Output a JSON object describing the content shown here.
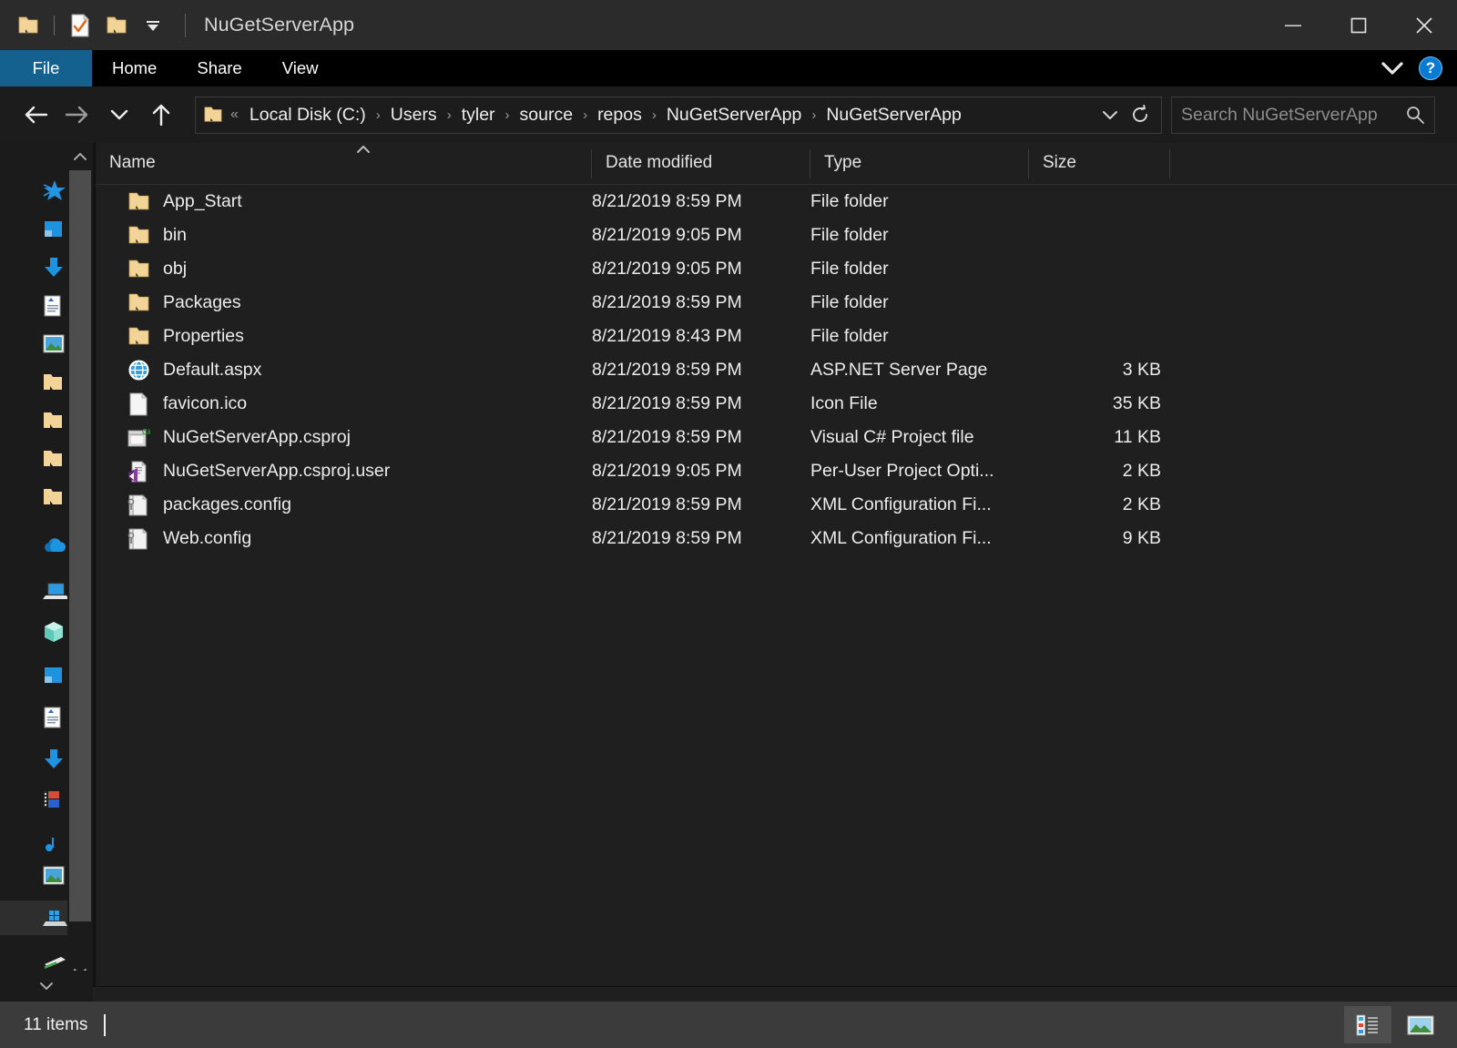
{
  "window": {
    "title": "NuGetServerApp",
    "controls": {
      "minimize": "minimize-icon",
      "maximize": "maximize-icon",
      "close": "close-icon"
    },
    "quick_access": [
      "folder-icon",
      "properties-icon",
      "new-folder-icon",
      "customize-dropdown-icon"
    ]
  },
  "ribbon": {
    "tabs": [
      {
        "label": "File",
        "active": true
      },
      {
        "label": "Home",
        "active": false
      },
      {
        "label": "Share",
        "active": false
      },
      {
        "label": "View",
        "active": false
      }
    ],
    "collapse_icon": "chevron-down-icon",
    "help_label": "?",
    "accent_color": "#14608f"
  },
  "navigation": {
    "back": "back-arrow-icon",
    "forward": "forward-arrow-icon",
    "recent": "chevron-down-icon",
    "up": "up-arrow-icon",
    "breadcrumb_overflow": "«",
    "breadcrumbs": [
      "Local Disk (C:)",
      "Users",
      "tyler",
      "source",
      "repos",
      "NuGetServerApp",
      "NuGetServerApp"
    ],
    "breadcrumb_separator": "›",
    "dropdown_icon": "chevron-down-icon",
    "refresh_icon": "refresh-icon"
  },
  "search": {
    "placeholder": "Search NuGetServerApp",
    "icon": "search-icon"
  },
  "columns": [
    {
      "label": "Name",
      "key": "name"
    },
    {
      "label": "Date modified",
      "key": "date"
    },
    {
      "label": "Type",
      "key": "type"
    },
    {
      "label": "Size",
      "key": "size"
    }
  ],
  "sort": {
    "column": "Name",
    "direction": "ascending",
    "indicator": "^"
  },
  "files": [
    {
      "name": "App_Start",
      "date": "8/21/2019 8:59 PM",
      "type": "File folder",
      "size": "",
      "icon": "folder-icon"
    },
    {
      "name": "bin",
      "date": "8/21/2019 9:05 PM",
      "type": "File folder",
      "size": "",
      "icon": "folder-icon"
    },
    {
      "name": "obj",
      "date": "8/21/2019 9:05 PM",
      "type": "File folder",
      "size": "",
      "icon": "folder-icon"
    },
    {
      "name": "Packages",
      "date": "8/21/2019 8:59 PM",
      "type": "File folder",
      "size": "",
      "icon": "folder-icon"
    },
    {
      "name": "Properties",
      "date": "8/21/2019 8:43 PM",
      "type": "File folder",
      "size": "",
      "icon": "folder-icon"
    },
    {
      "name": "Default.aspx",
      "date": "8/21/2019 8:59 PM",
      "type": "ASP.NET Server Page",
      "size": "3 KB",
      "icon": "globe-icon"
    },
    {
      "name": "favicon.ico",
      "date": "8/21/2019 8:59 PM",
      "type": "Icon File",
      "size": "35 KB",
      "icon": "blank-document-icon"
    },
    {
      "name": "NuGetServerApp.csproj",
      "date": "8/21/2019 8:59 PM",
      "type": "Visual C# Project file",
      "size": "11 KB",
      "icon": "csharp-project-icon"
    },
    {
      "name": "NuGetServerApp.csproj.user",
      "date": "8/21/2019 9:05 PM",
      "type": "Per-User Project Opti...",
      "size": "2 KB",
      "icon": "visual-studio-file-icon"
    },
    {
      "name": "packages.config",
      "date": "8/21/2019 8:59 PM",
      "type": "XML Configuration Fi...",
      "size": "2 KB",
      "icon": "config-file-icon"
    },
    {
      "name": "Web.config",
      "date": "8/21/2019 8:59 PM",
      "type": "XML Configuration Fi...",
      "size": "9 KB",
      "icon": "config-file-icon"
    }
  ],
  "sidebar": {
    "scroll_up": "chevron-up-icon",
    "scroll_down": "chevron-down-icon",
    "items": [
      {
        "icon": "quick-access-star-icon"
      },
      {
        "icon": "onedrive-folder-icon"
      },
      {
        "icon": "downloads-icon"
      },
      {
        "icon": "documents-icon"
      },
      {
        "icon": "pictures-icon"
      },
      {
        "icon": "folder-icon"
      },
      {
        "icon": "folder-icon"
      },
      {
        "icon": "folder-icon"
      },
      {
        "icon": "folder-icon"
      },
      {
        "icon": "onedrive-cloud-icon"
      },
      {
        "icon": "this-pc-icon"
      },
      {
        "icon": "3d-objects-icon"
      },
      {
        "icon": "onedrive-folder-icon"
      },
      {
        "icon": "documents-icon"
      },
      {
        "icon": "downloads-icon"
      },
      {
        "icon": "videos-icon"
      },
      {
        "icon": "music-icon"
      },
      {
        "icon": "pictures-icon"
      },
      {
        "icon": "local-disk-icon"
      },
      {
        "icon": "network-icon"
      }
    ]
  },
  "status": {
    "item_count": "11 items",
    "collapse_icon": "chevron-down-icon",
    "views": [
      {
        "name": "details-view",
        "active": true
      },
      {
        "name": "large-icons-view",
        "active": false
      }
    ]
  }
}
